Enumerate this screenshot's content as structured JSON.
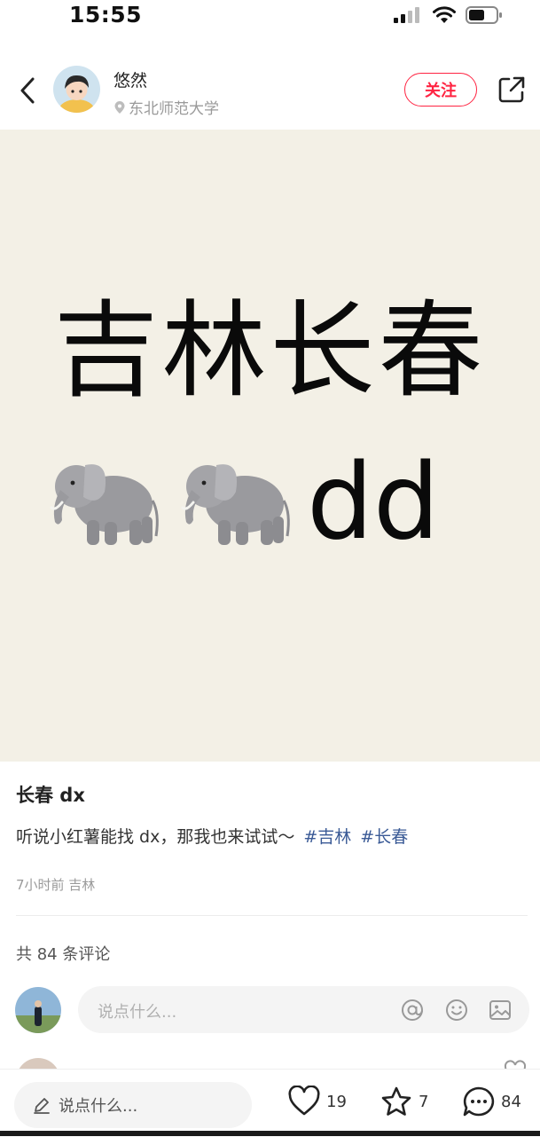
{
  "status_bar": {
    "time": "15:55",
    "icons": [
      "cellular-signal-icon",
      "wifi-icon",
      "battery-icon"
    ]
  },
  "header": {
    "back_icon": "chevron-left-icon",
    "author": {
      "name": "悠然",
      "location": "东北师范大学",
      "location_icon": "location-pin-icon"
    },
    "follow_label": "关注",
    "share_icon": "share-icon"
  },
  "post_image": {
    "line1": "吉林长春",
    "emoji": [
      "🐘",
      "🐘"
    ],
    "line2_suffix": "dd",
    "background": "#f3f0e6"
  },
  "post": {
    "title": "长春 dx",
    "body": "听说小红薯能找 dx，那我也来试试～",
    "hashtags": [
      "#吉林",
      "#长春"
    ],
    "meta": "7小时前 吉林"
  },
  "comments": {
    "count_label": "共 84 条评论",
    "input_placeholder": "说点什么...",
    "input_icons": [
      "at-icon",
      "emoji-icon",
      "image-icon"
    ]
  },
  "bottom_bar": {
    "input_placeholder": "说点什么...",
    "like_count": "19",
    "collect_count": "7",
    "comment_count": "84"
  },
  "colors": {
    "accent": "#ff2442",
    "hashtag": "#3a5a96"
  }
}
